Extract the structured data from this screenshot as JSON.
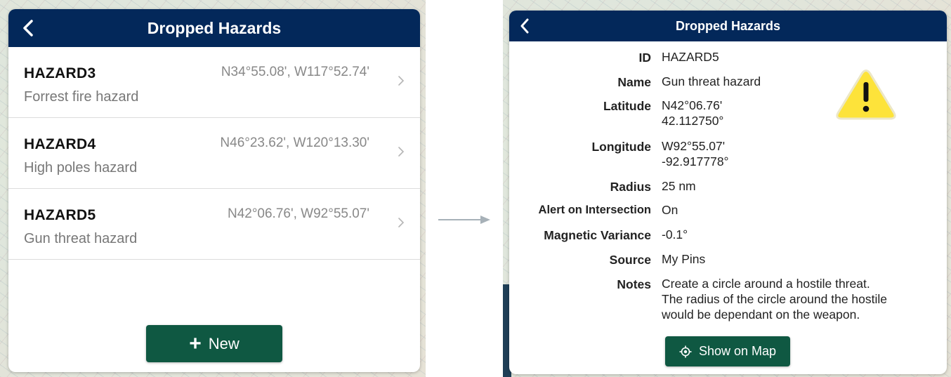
{
  "list_panel": {
    "title": "Dropped Hazards",
    "items": [
      {
        "name": "HAZARD3",
        "description": "Forrest fire hazard",
        "coords": "N34°55.08', W117°52.74'"
      },
      {
        "name": "HAZARD4",
        "description": "High poles hazard",
        "coords": "N46°23.62', W120°13.30'"
      },
      {
        "name": "HAZARD5",
        "description": "Gun threat hazard",
        "coords": "N42°06.76', W92°55.07'"
      }
    ],
    "new_button": {
      "icon": "+",
      "label": "New"
    }
  },
  "detail_panel": {
    "title": "Dropped Hazards",
    "fields": {
      "id": {
        "label": "ID",
        "value": "HAZARD5"
      },
      "name": {
        "label": "Name",
        "value": "Gun threat hazard"
      },
      "latitude": {
        "label": "Latitude",
        "value_dms": "N42°06.76'",
        "value_dec": "42.112750°"
      },
      "longitude": {
        "label": "Longitude",
        "value_dms": "W92°55.07'",
        "value_dec": "-92.917778°"
      },
      "radius": {
        "label": "Radius",
        "value": "25 nm"
      },
      "alert": {
        "label": "Alert on Intersection",
        "value": "On"
      },
      "magvar": {
        "label": "Magnetic Variance",
        "value": "-0.1°"
      },
      "source": {
        "label": "Source",
        "value": "My Pins"
      },
      "notes": {
        "label": "Notes",
        "lines": [
          "Create a circle around a hostile threat.",
          "The radius of the circle around the hostile",
          "would be dependant on the weapon."
        ]
      }
    },
    "show_map_button": {
      "label": "Show on Map"
    },
    "hazard_icon": "warning-triangle-icon"
  },
  "colors": {
    "header": "#03285a",
    "button": "#0f5842",
    "warning": "#fde33a"
  }
}
